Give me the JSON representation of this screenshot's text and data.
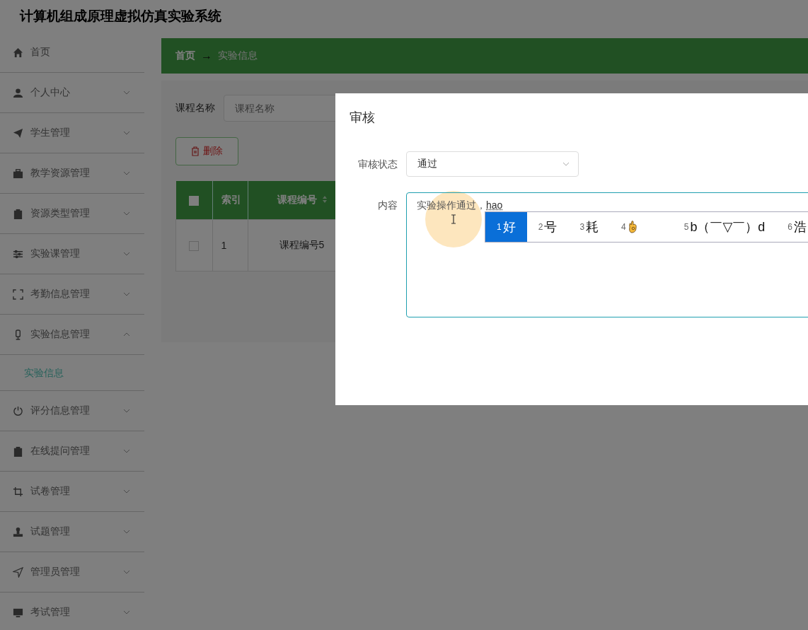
{
  "header": {
    "title": "计算机组成原理虚拟仿真实验系统"
  },
  "sidebar": {
    "items": [
      {
        "kind": "link",
        "label": "首页"
      },
      {
        "kind": "menu",
        "label": "个人中心",
        "expanded": false
      },
      {
        "kind": "menu",
        "label": "学生管理",
        "expanded": false
      },
      {
        "kind": "menu",
        "label": "教学资源管理",
        "expanded": false
      },
      {
        "kind": "menu",
        "label": "资源类型管理",
        "expanded": false
      },
      {
        "kind": "menu",
        "label": "实验课管理",
        "expanded": false
      },
      {
        "kind": "menu",
        "label": "考勤信息管理",
        "expanded": false
      },
      {
        "kind": "menu",
        "label": "实验信息管理",
        "expanded": true,
        "children": [
          {
            "label": "实验信息",
            "selected": true
          }
        ]
      },
      {
        "kind": "menu",
        "label": "评分信息管理",
        "expanded": false
      },
      {
        "kind": "menu",
        "label": "在线提问管理",
        "expanded": false
      },
      {
        "kind": "menu",
        "label": "试卷管理",
        "expanded": false
      },
      {
        "kind": "menu",
        "label": "试题管理",
        "expanded": false
      },
      {
        "kind": "menu",
        "label": "管理员管理",
        "expanded": false
      },
      {
        "kind": "menu",
        "label": "考试管理",
        "expanded": false
      }
    ]
  },
  "breadcrumb": {
    "home": "首页",
    "separator": "→",
    "current": "实验信息"
  },
  "search": {
    "label": "课程名称",
    "placeholder": "课程名称"
  },
  "delete_button": {
    "label": "删除"
  },
  "table": {
    "columns": [
      {
        "kind": "checkbox",
        "checked": false
      },
      {
        "kind": "text",
        "label": "索引"
      },
      {
        "kind": "sortable",
        "label": "课程编号"
      }
    ],
    "rows": [
      {
        "cells": [
          {
            "kind": "checkbox",
            "checked": false
          },
          {
            "kind": "text",
            "text": "1"
          },
          {
            "kind": "text",
            "text": "课程编号5"
          }
        ]
      }
    ]
  },
  "dialog": {
    "title": "审核",
    "fields": [
      {
        "kind": "select",
        "label": "审核状态",
        "value": "通过"
      },
      {
        "kind": "textarea",
        "label": "内容",
        "value": "实验操作通过，",
        "composition": "hao"
      }
    ]
  },
  "ime": {
    "candidates": [
      {
        "kind": "text",
        "number": "1",
        "text": "好",
        "selected": true
      },
      {
        "kind": "text",
        "number": "2",
        "text": "号",
        "selected": false
      },
      {
        "kind": "text",
        "number": "3",
        "text": "耗",
        "selected": false
      },
      {
        "kind": "emoji",
        "number": "4",
        "selected": false
      },
      {
        "kind": "text",
        "number": "5",
        "text": "b（￣▽￣）d",
        "selected": false
      },
      {
        "kind": "text",
        "number": "6",
        "text": "浩",
        "selected": false
      }
    ]
  }
}
